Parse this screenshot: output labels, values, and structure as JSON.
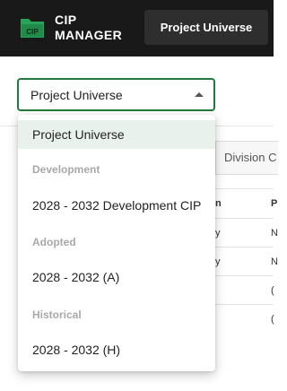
{
  "header": {
    "logo_line1": "CIP",
    "logo_line2": "MANAGER",
    "logo_icon_label": "CIP",
    "project_button": "Project Universe"
  },
  "background": {
    "tab_label": "Division C",
    "table_header": [
      "n",
      "P"
    ],
    "table_rows": [
      [
        "y",
        "N"
      ],
      [
        "y",
        "N"
      ],
      [
        "",
        "("
      ],
      [
        "",
        "("
      ]
    ]
  },
  "select": {
    "value": "Project Universe",
    "options": [
      {
        "type": "option",
        "label": "Project Universe",
        "selected": true
      },
      {
        "type": "group",
        "label": "Development"
      },
      {
        "type": "option",
        "label": "2028 - 2032 Development CIP"
      },
      {
        "type": "group",
        "label": "Adopted"
      },
      {
        "type": "option",
        "label": "2028 - 2032 (A)"
      },
      {
        "type": "group",
        "label": "Historical"
      },
      {
        "type": "option",
        "label": "2028 - 2032 (H)"
      }
    ]
  },
  "colors": {
    "header_bg": "#191919",
    "accent_green": "#217a3c",
    "selected_bg": "#e9f1ec"
  }
}
